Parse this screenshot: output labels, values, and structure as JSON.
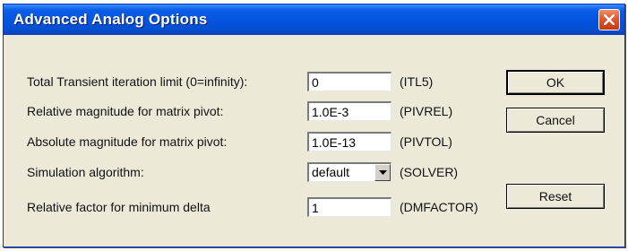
{
  "window": {
    "title": "Advanced Analog Options"
  },
  "rows": [
    {
      "label": "Total Transient iteration limit (0=infinity):",
      "value": "0",
      "param": "(ITL5)"
    },
    {
      "label": "Relative magnitude for matrix pivot:",
      "value": "1.0E-3",
      "param": "(PIVREL)"
    },
    {
      "label": "Absolute magnitude for matrix pivot:",
      "value": "1.0E-13",
      "param": "(PIVTOL)"
    },
    {
      "label": "Simulation algorithm:",
      "value": "default",
      "param": "(SOLVER)"
    },
    {
      "label": "Relative factor for minimum delta",
      "value": "1",
      "param": "(DMFACTOR)"
    }
  ],
  "buttons": {
    "ok": "OK",
    "cancel": "Cancel",
    "reset": "Reset"
  },
  "icons": {
    "close": "close-icon",
    "dropdown": "chevron-down-icon"
  },
  "colors": {
    "titlebar": "#0454e0",
    "dialog_bg": "#ece9d8",
    "close_button": "#e2582e"
  }
}
